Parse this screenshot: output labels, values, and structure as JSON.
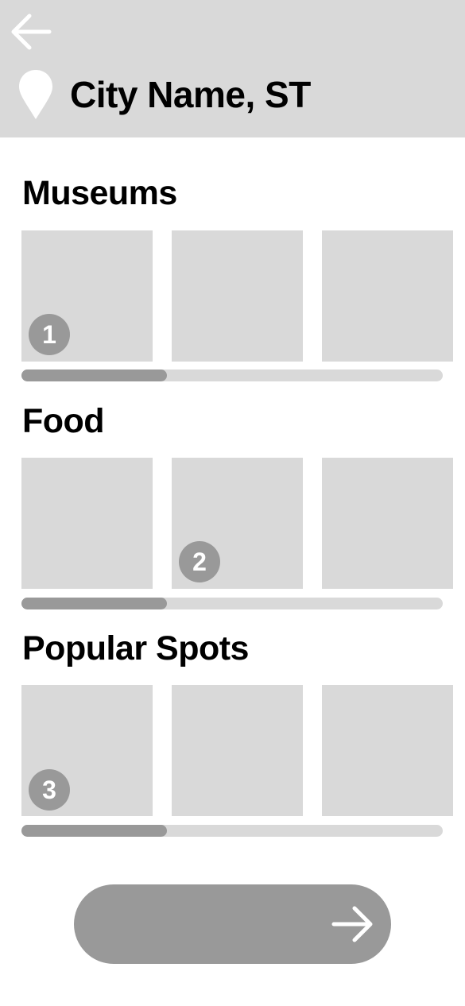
{
  "header": {
    "back_icon": "arrow-left-icon",
    "location_icon": "map-pin-icon",
    "title": "City Name, ST"
  },
  "sections": [
    {
      "title": "Museums",
      "badge": "1",
      "badge_tile": 1,
      "scroll_fraction": 0.345
    },
    {
      "title": "Food",
      "badge": "2",
      "badge_tile": 2,
      "scroll_fraction": 0.345
    },
    {
      "title": "Popular Spots",
      "badge": "3",
      "badge_tile": 1,
      "scroll_fraction": 0.345
    }
  ],
  "next_button": {
    "icon": "arrow-right-icon"
  },
  "colors": {
    "header_bg": "#d9d9d9",
    "tile_bg": "#d9d9d9",
    "accent_gray": "#999999",
    "text": "#000000"
  }
}
